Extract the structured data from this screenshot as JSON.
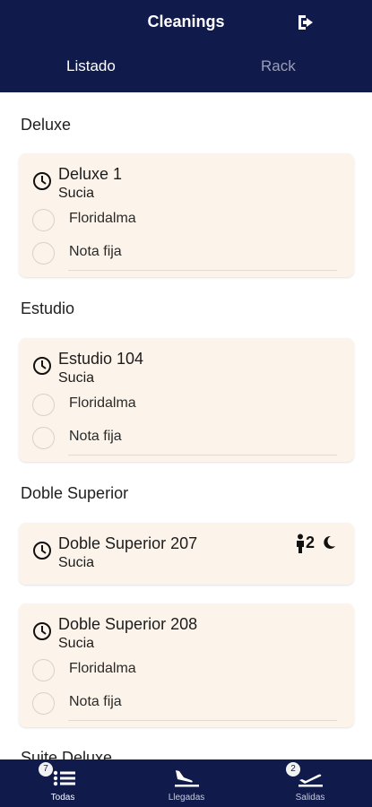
{
  "header": {
    "title": "Cleanings",
    "logout_icon": "logout-icon",
    "tabs": [
      {
        "label": "Listado",
        "active": true
      },
      {
        "label": "Rack",
        "active": false
      }
    ]
  },
  "sections": [
    {
      "title": "Deluxe",
      "cards": [
        {
          "room": "Deluxe 1",
          "status": "Sucia",
          "options": [
            "Floridalma",
            "Nota fija"
          ]
        }
      ]
    },
    {
      "title": "Estudio",
      "cards": [
        {
          "room": "Estudio 104",
          "status": "Sucia",
          "options": [
            "Floridalma",
            "Nota fija"
          ]
        }
      ]
    },
    {
      "title": "Doble Superior",
      "cards": [
        {
          "room": "Doble Superior 207",
          "status": "Sucia",
          "guests": "2",
          "icons": [
            "person-icon",
            "moon-icon"
          ]
        },
        {
          "room": "Doble Superior 208",
          "status": "Sucia",
          "options": [
            "Floridalma",
            "Nota fija"
          ]
        }
      ]
    },
    {
      "title": "Suite Deluxe",
      "cards": []
    }
  ],
  "bottom_nav": [
    {
      "label": "Todas",
      "badge": "7",
      "icon": "list-icon",
      "active": true
    },
    {
      "label": "Llegadas",
      "icon": "plane-landing-icon",
      "active": false
    },
    {
      "label": "Salidas",
      "badge": "2",
      "icon": "plane-departure-icon",
      "active": false
    }
  ],
  "colors": {
    "header_bg": "#101a4b",
    "card_bg": "#fcf4ea",
    "text": "#1c1c1c"
  }
}
